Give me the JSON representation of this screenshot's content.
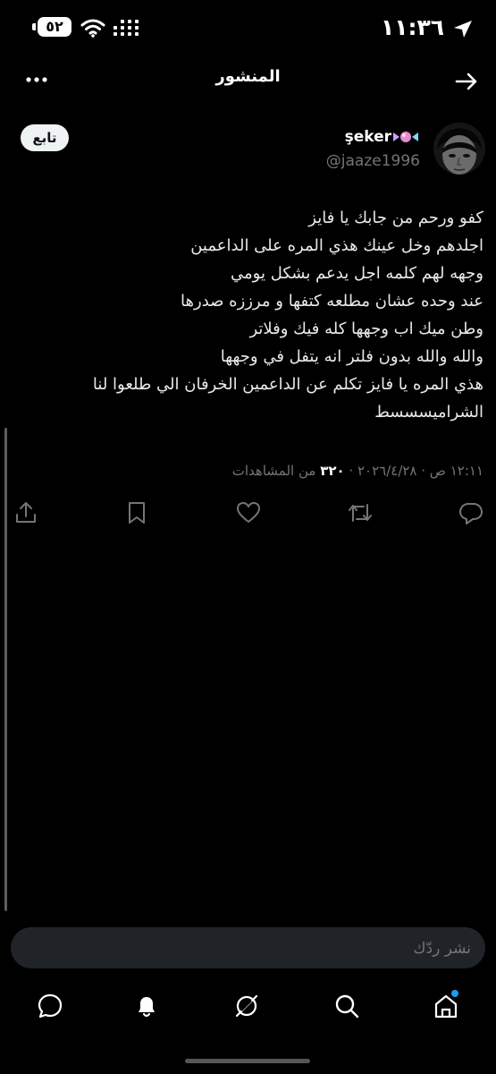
{
  "status_bar": {
    "time": "١١:٣٦",
    "battery": "٥٢",
    "icons": [
      "location-icon",
      "wifi-icon",
      "signal-icon",
      "battery-icon"
    ]
  },
  "header": {
    "title": "المنشور",
    "back_icon": "arrow-right-icon",
    "more_icon": "more-horizontal-icon"
  },
  "author": {
    "name": "şeker",
    "handle": "@jaaze1996",
    "follow_label": "تابع",
    "name_decoration": "candy-emoji"
  },
  "tweet": {
    "lines": [
      "كفو ورحم من جابك يا فايز",
      "اجلدهم وخل عينك هذي المره على الداعمين",
      "وجهه لهم كلمه اجل يدعم بشكل يومي",
      "عند وحده عشان مطلعه كتفها و مرززه صدرها",
      "وطن ميك اب وجهها كله فيك وفلاتر",
      "والله والله بدون فلتر انه يتفل في وجهها",
      "هذي المره يا فايز تكلم عن الداعمين الخرفان الي طلعوا لنا",
      "الشراميسسسط"
    ]
  },
  "meta": {
    "datetime": "١٢:١١ ص · ٢٠٢٦/٤/٢٨ · ",
    "views_count": "٣٢٠",
    "views_label": " من المشاهدات"
  },
  "actions": [
    "reply-icon",
    "retweet-icon",
    "like-icon",
    "bookmark-icon",
    "share-icon"
  ],
  "reply": {
    "placeholder": "نشر ردّك"
  },
  "bottom_nav": [
    "home-icon",
    "search-icon",
    "grok-icon",
    "notifications-icon",
    "messages-icon"
  ],
  "colors": {
    "background": "#000000",
    "text": "#e7e9ea",
    "secondary": "#71767b",
    "accent": "#1d9bf0",
    "input_bg": "#202327"
  }
}
